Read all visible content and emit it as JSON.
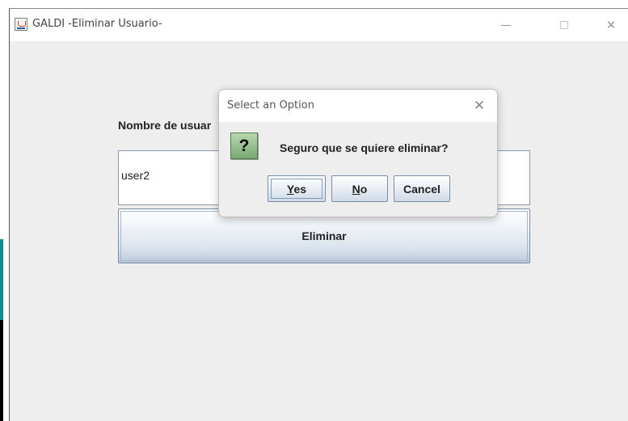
{
  "window": {
    "title": "GALDI -Eliminar Usuario-",
    "controls": {
      "minimize": "minimize",
      "maximize": "maximize",
      "close": "close"
    }
  },
  "form": {
    "username_label": "Nombre de usuar",
    "username_value": "user2",
    "delete_button": "Eliminar"
  },
  "dialog": {
    "title": "Select an Option",
    "message": "Seguro que se quiere eliminar?",
    "icon": "question-icon",
    "icon_glyph": "?",
    "buttons": {
      "yes": {
        "mnemonic": "Y",
        "rest": "es"
      },
      "no": {
        "mnemonic": "N",
        "rest": "o"
      },
      "cancel": "Cancel"
    }
  },
  "colors": {
    "window_bg": "#eeeeee",
    "titlebar_bg": "#ffffff",
    "button_border": "#7a8ea8",
    "icon_green": "#7aa874"
  }
}
